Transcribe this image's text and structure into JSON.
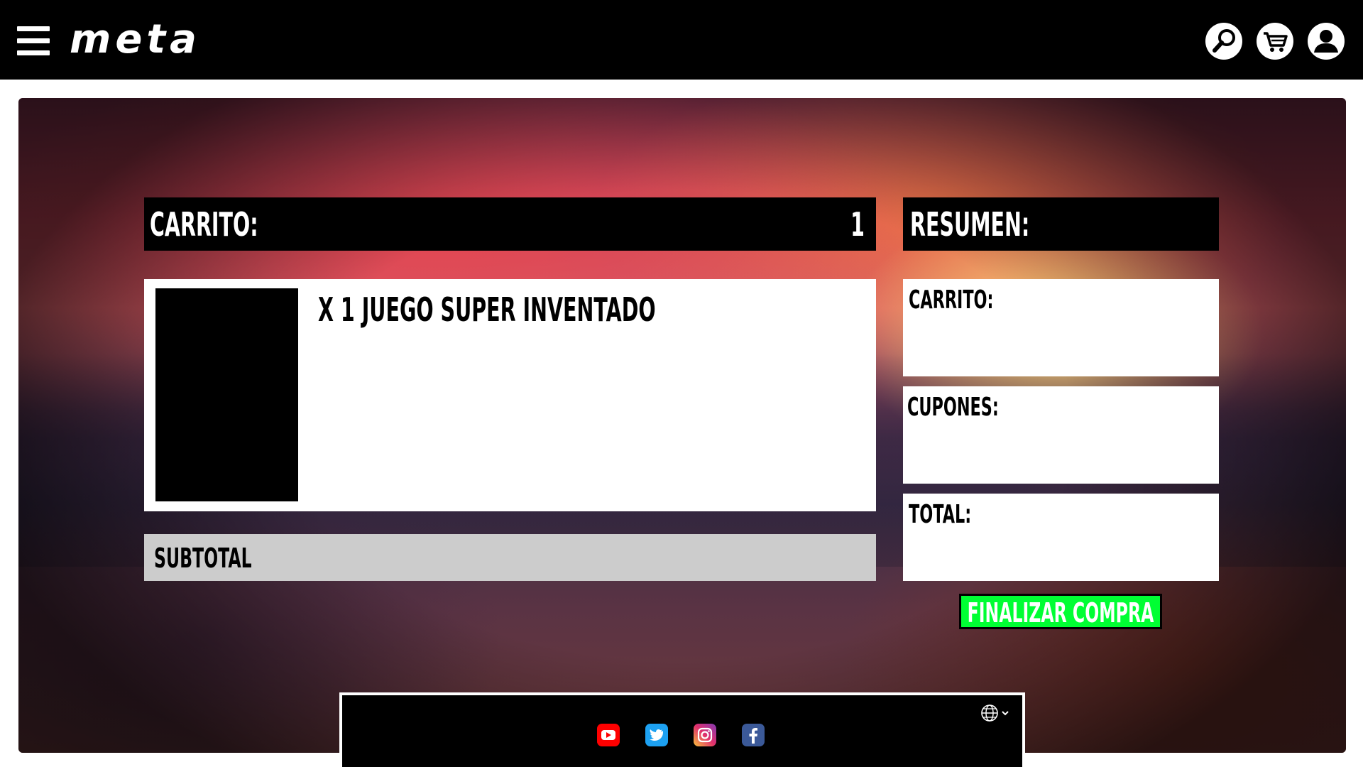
{
  "header": {
    "logo": "meta",
    "icons": [
      "menu-icon",
      "search-icon",
      "cart-icon",
      "user-icon"
    ]
  },
  "cart": {
    "title": "CARRITO:",
    "count": "1",
    "items": [
      {
        "name": "X 1 JUEGO SUPER INVENTADO"
      }
    ],
    "subtotal_label": "SUBTOTAL"
  },
  "summary": {
    "title": "RESUMEN:",
    "cart_label": "CARRITO:",
    "coupons_label": "CUPONES:",
    "total_label": "TOTAL:"
  },
  "checkout": {
    "label": "FINALIZAR COMPRA",
    "color": "#00ff33"
  },
  "footer": {
    "social": [
      "youtube-icon",
      "twitter-icon",
      "instagram-icon",
      "facebook-icon"
    ],
    "language_icon": "globe-icon"
  }
}
